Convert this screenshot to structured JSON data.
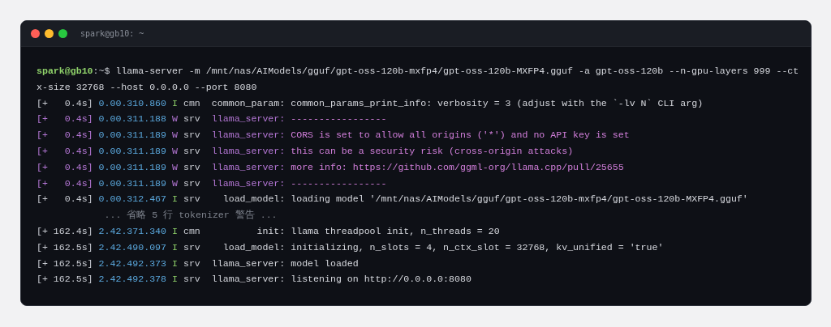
{
  "window": {
    "title": "spark@gb10: ~"
  },
  "prompt": {
    "user_host": "spark@gb10",
    "path": ":~$",
    "command": "llama-server -m /mnt/nas/AIModels/gguf/gpt-oss-120b-mxfp4/gpt-oss-120b-MXFP4.gguf -a gpt-oss-120b --n-gpu-layers 999 --ctx-size 32768 --host 0.0.0.0 --port 8080"
  },
  "lines": [
    {
      "kind": "info",
      "elapsed": "[+   0.4s]",
      "timestamp": "0.00.310.860",
      "level": "I",
      "module": "cmn",
      "source": "common_param:",
      "message": "common_params_print_info: verbosity = 3 (adjust with the `-lv N` CLI arg)"
    },
    {
      "kind": "warn",
      "elapsed": "[+   0.4s]",
      "timestamp": "0.00.311.188",
      "level": "W",
      "module": "srv",
      "source": "llama_server:",
      "message": "-----------------"
    },
    {
      "kind": "warn",
      "elapsed": "[+   0.4s]",
      "timestamp": "0.00.311.189",
      "level": "W",
      "module": "srv",
      "source": "llama_server:",
      "message": "CORS is set to allow all origins ('*') and no API key is set"
    },
    {
      "kind": "warn",
      "elapsed": "[+   0.4s]",
      "timestamp": "0.00.311.189",
      "level": "W",
      "module": "srv",
      "source": "llama_server:",
      "message": "this can be a security risk (cross-origin attacks)"
    },
    {
      "kind": "warn",
      "elapsed": "[+   0.4s]",
      "timestamp": "0.00.311.189",
      "level": "W",
      "module": "srv",
      "source": "llama_server:",
      "message": "more info: https://github.com/ggml-org/llama.cpp/pull/25655"
    },
    {
      "kind": "warn",
      "elapsed": "[+   0.4s]",
      "timestamp": "0.00.311.189",
      "level": "W",
      "module": "srv",
      "source": "llama_server:",
      "message": "-----------------"
    },
    {
      "kind": "info",
      "elapsed": "[+   0.4s]",
      "timestamp": "0.00.312.467",
      "level": "I",
      "module": "srv",
      "source": "load_model:",
      "message": "loading model '/mnt/nas/AIModels/gguf/gpt-oss-120b-mxfp4/gpt-oss-120b-MXFP4.gguf'"
    },
    {
      "kind": "note",
      "message": "... 省略 5 行 tokenizer 警告 ..."
    },
    {
      "kind": "info",
      "elapsed": "[+ 162.4s]",
      "timestamp": "2.42.371.340",
      "level": "I",
      "module": "cmn",
      "source": "init:",
      "message": "llama threadpool init, n_threads = 20"
    },
    {
      "kind": "info",
      "elapsed": "[+ 162.5s]",
      "timestamp": "2.42.490.097",
      "level": "I",
      "module": "srv",
      "source": "load_model:",
      "message": "initializing, n_slots = 4, n_ctx_slot = 32768, kv_unified = 'true'"
    },
    {
      "kind": "info",
      "elapsed": "[+ 162.5s]",
      "timestamp": "2.42.492.373",
      "level": "I",
      "module": "srv",
      "source": "llama_server:",
      "message": "model loaded"
    },
    {
      "kind": "info",
      "elapsed": "[+ 162.5s]",
      "timestamp": "2.42.492.378",
      "level": "I",
      "module": "srv",
      "source": "llama_server:",
      "message": "listening on http://0.0.0.0:8080"
    }
  ]
}
